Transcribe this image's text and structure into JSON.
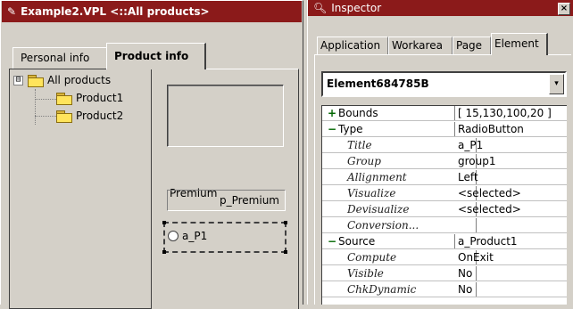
{
  "left_window": {
    "title": "Example2.VPL <::All products>",
    "tabs": [
      "Personal info",
      "Product info"
    ],
    "tree": {
      "root": "All products",
      "root_expander": "⊟",
      "children": [
        "Product1",
        "Product2"
      ]
    },
    "premium_label": "Premium",
    "premium_field": "p_Premium",
    "radio_label": "a_P1"
  },
  "inspector": {
    "title": "Inspector",
    "close": "×",
    "tabs": [
      "Application",
      "Workarea",
      "Page",
      "Element"
    ],
    "element_name": "Element684785B",
    "combo_arrow": "▾",
    "rows": [
      {
        "name": "Bounds",
        "value": "[ 15,130,100,20 ]",
        "kind": "cat",
        "expander": "+"
      },
      {
        "name": "Type",
        "value": "RadioButton",
        "kind": "cat",
        "expander": "−"
      },
      {
        "name": "Title",
        "value": "a_P1",
        "kind": "sub"
      },
      {
        "name": "Group",
        "value": "group1",
        "kind": "sub"
      },
      {
        "name": "Allignment",
        "value": "Left",
        "kind": "sub"
      },
      {
        "name": "Visualize",
        "value": "<selected>",
        "kind": "sub"
      },
      {
        "name": "Devisualize",
        "value": "<selected>",
        "kind": "sub"
      },
      {
        "name": "Conversion...",
        "value": "",
        "kind": "sub"
      },
      {
        "name": "Source",
        "value": "a_Product1",
        "kind": "cat",
        "expander": "−"
      },
      {
        "name": "Compute",
        "value": "OnExit",
        "kind": "sub"
      },
      {
        "name": "Visible",
        "value": "No",
        "kind": "sub"
      },
      {
        "name": "ChkDynamic",
        "value": "No",
        "kind": "sub"
      }
    ]
  },
  "colors": {
    "titlebar": "#8b1a1a",
    "face": "#d4d0c8",
    "folder": "#ffe45c"
  }
}
